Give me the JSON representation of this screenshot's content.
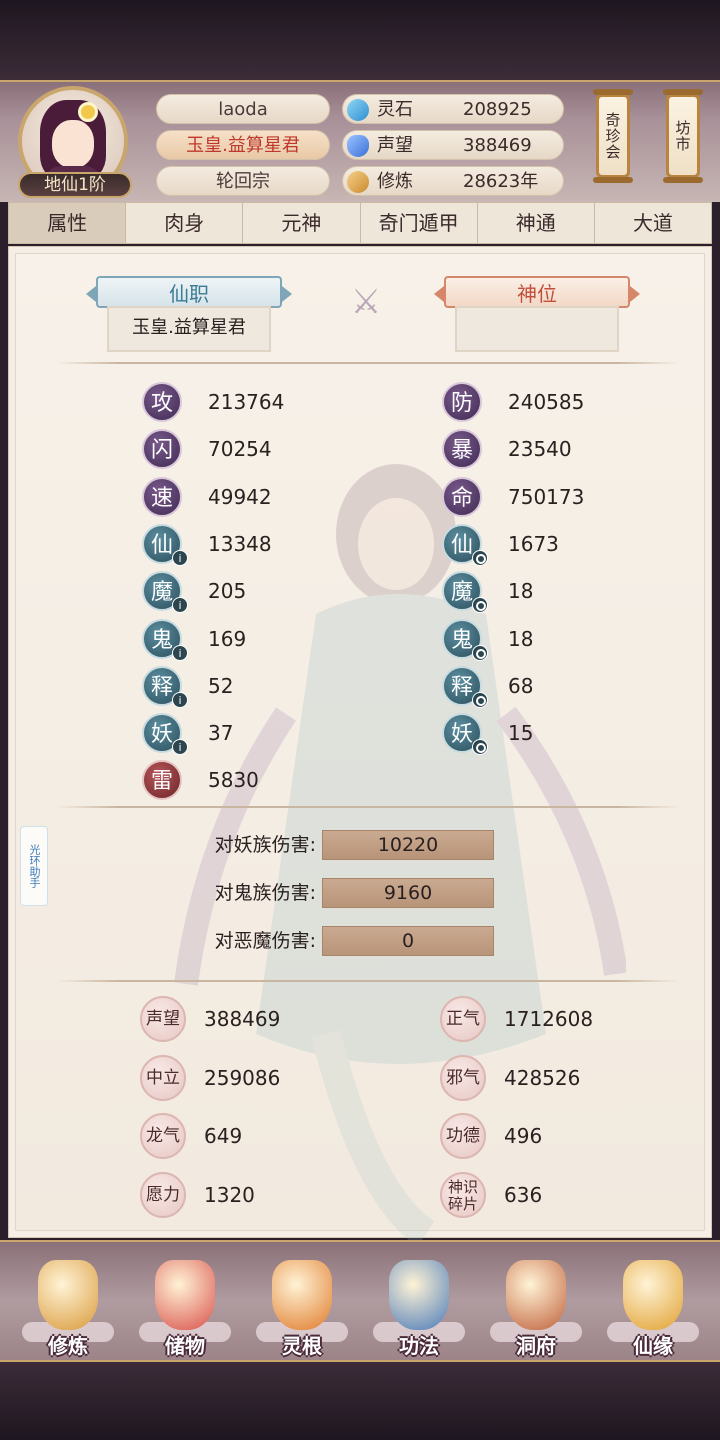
{
  "header": {
    "rank": "地仙1阶",
    "player_name": "laoda",
    "title": "玉皇.益算星君",
    "sect": "轮回宗",
    "resources": [
      {
        "label": "灵石",
        "value": "208925",
        "icon": "crystal-icon",
        "color": "#3fa8e0"
      },
      {
        "label": "声望",
        "value": "388469",
        "icon": "gem-icon",
        "color": "#4a8fe8"
      },
      {
        "label": "修炼",
        "value": "28623年",
        "icon": "meditation-icon",
        "color": "#e0a040"
      }
    ],
    "buttons": {
      "treasure": "奇珍会",
      "market": "坊市"
    }
  },
  "tabs": [
    "属性",
    "肉身",
    "元神",
    "奇门遁甲",
    "神通",
    "大道"
  ],
  "active_tab": 0,
  "panel": {
    "immortal_post_label": "仙职",
    "immortal_post_value": "玉皇.益算星君",
    "divine_rank_label": "神位",
    "divine_rank_value": "",
    "stats_left": [
      {
        "char": "攻",
        "value": "213764",
        "style": "purple",
        "badge": ""
      },
      {
        "char": "闪",
        "value": "70254",
        "style": "purple",
        "badge": ""
      },
      {
        "char": "速",
        "value": "49942",
        "style": "purple",
        "badge": ""
      },
      {
        "char": "仙",
        "value": "13348",
        "style": "teal",
        "badge": "info"
      },
      {
        "char": "魔",
        "value": "205",
        "style": "teal",
        "badge": "info"
      },
      {
        "char": "鬼",
        "value": "169",
        "style": "teal",
        "badge": "info"
      },
      {
        "char": "释",
        "value": "52",
        "style": "teal",
        "badge": "info"
      },
      {
        "char": "妖",
        "value": "37",
        "style": "teal",
        "badge": "info"
      },
      {
        "char": "雷",
        "value": "5830",
        "style": "red",
        "badge": ""
      }
    ],
    "stats_right": [
      {
        "char": "防",
        "value": "240585",
        "style": "purple",
        "badge": ""
      },
      {
        "char": "暴",
        "value": "23540",
        "style": "purple",
        "badge": ""
      },
      {
        "char": "命",
        "value": "750173",
        "style": "purple",
        "badge": ""
      },
      {
        "char": "仙",
        "value": "1673",
        "style": "teal",
        "badge": "circle"
      },
      {
        "char": "魔",
        "value": "18",
        "style": "teal",
        "badge": "circle"
      },
      {
        "char": "鬼",
        "value": "18",
        "style": "teal",
        "badge": "circle"
      },
      {
        "char": "释",
        "value": "68",
        "style": "teal",
        "badge": "circle"
      },
      {
        "char": "妖",
        "value": "15",
        "style": "teal",
        "badge": "circle"
      }
    ],
    "damage": [
      {
        "label": "对妖族伤害:",
        "value": "10220"
      },
      {
        "label": "对鬼族伤害:",
        "value": "9160"
      },
      {
        "label": "对恶魔伤害:",
        "value": "0"
      }
    ],
    "reputation_left": [
      {
        "char": "声望",
        "value": "388469"
      },
      {
        "char": "中立",
        "value": "259086"
      },
      {
        "char": "龙气",
        "value": "649"
      },
      {
        "char": "愿力",
        "value": "1320"
      }
    ],
    "reputation_right": [
      {
        "char": "正气",
        "value": "1712608"
      },
      {
        "char": "邪气",
        "value": "428526"
      },
      {
        "char": "功德",
        "value": "496"
      },
      {
        "char": "神识碎片",
        "value": "636"
      }
    ],
    "helper_label": "光环助手"
  },
  "bottom_nav": [
    {
      "label": "修炼",
      "icon": "meditation-monk-icon",
      "color": "#d99a3a"
    },
    {
      "label": "储物",
      "icon": "bag-icon",
      "color": "#d9504a"
    },
    {
      "label": "灵根",
      "icon": "spirit-root-icon",
      "color": "#e07a2a"
    },
    {
      "label": "功法",
      "icon": "book-icon",
      "color": "#4a7ab8"
    },
    {
      "label": "洞府",
      "icon": "mansion-icon",
      "color": "#c0603a"
    },
    {
      "label": "仙缘",
      "icon": "gourd-icon",
      "color": "#e0a030"
    }
  ]
}
